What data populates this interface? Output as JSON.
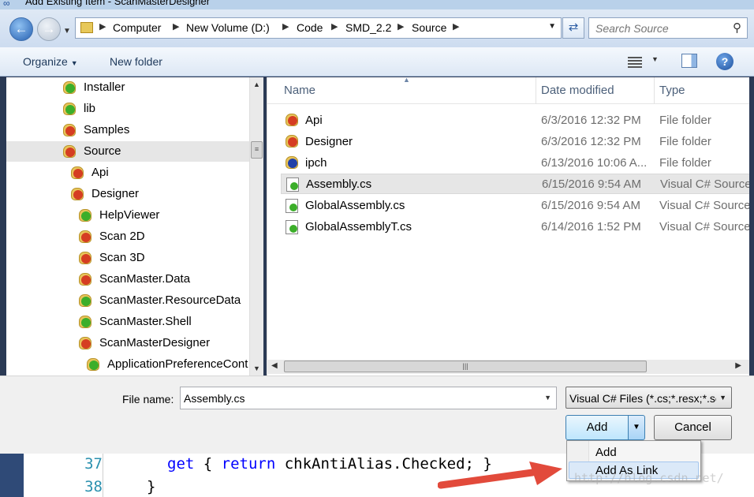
{
  "window": {
    "title": "Add Existing Item - ScanMasterDesigner"
  },
  "address": {
    "crumbs": [
      "Computer",
      "New Volume (D:)",
      "Code",
      "SMD_2.2",
      "Source"
    ]
  },
  "search": {
    "placeholder": "Search Source"
  },
  "toolbar": {
    "organize_label": "Organize",
    "new_folder_label": "New folder"
  },
  "tree": {
    "items": [
      {
        "label": "Installer",
        "badge": "green"
      },
      {
        "label": "lib",
        "badge": "green"
      },
      {
        "label": "Samples",
        "badge": "red"
      },
      {
        "label": "Source",
        "badge": "red",
        "selected": true
      },
      {
        "label": "Api",
        "badge": "red"
      },
      {
        "label": "Designer",
        "badge": "red"
      },
      {
        "label": "HelpViewer",
        "badge": "green"
      },
      {
        "label": "Scan 2D",
        "badge": "red"
      },
      {
        "label": "Scan 3D",
        "badge": "red"
      },
      {
        "label": "ScanMaster.Data",
        "badge": "red"
      },
      {
        "label": "ScanMaster.ResourceData",
        "badge": "green"
      },
      {
        "label": "ScanMaster.Shell",
        "badge": "green"
      },
      {
        "label": "ScanMasterDesigner",
        "badge": "red"
      },
      {
        "label": "ApplicationPreferenceCont",
        "badge": "green"
      }
    ]
  },
  "filelist": {
    "columns": {
      "name": "Name",
      "date": "Date modified",
      "type": "Type"
    },
    "rows": [
      {
        "name": "Api",
        "date": "6/3/2016 12:32 PM",
        "type": "File folder",
        "icon": "folder-red"
      },
      {
        "name": "Designer",
        "date": "6/3/2016 12:32 PM",
        "type": "File folder",
        "icon": "folder-red"
      },
      {
        "name": "ipch",
        "date": "6/13/2016 10:06 A...",
        "type": "File folder",
        "icon": "folder-blue"
      },
      {
        "name": "Assembly.cs",
        "date": "6/15/2016 9:54 AM",
        "type": "Visual C# Source",
        "icon": "cs-file-blue",
        "selected": true
      },
      {
        "name": "GlobalAssembly.cs",
        "date": "6/15/2016 9:54 AM",
        "type": "Visual C# Source",
        "icon": "cs-file"
      },
      {
        "name": "GlobalAssemblyT.cs",
        "date": "6/14/2016 1:52 PM",
        "type": "Visual C# Source",
        "icon": "cs-file-green"
      }
    ]
  },
  "bottom": {
    "filename_label": "File name:",
    "filename_value": "Assembly.cs",
    "filetype_value": "Visual C# Files (*.cs;*.resx;*.se",
    "add_label": "Add",
    "cancel_label": "Cancel"
  },
  "add_menu": {
    "items": [
      "Add",
      "Add As Link"
    ],
    "highlighted": "Add As Link"
  },
  "editor": {
    "lines": [
      {
        "number": "37",
        "kw1": "get",
        "kw2": "return",
        "rest": " chkAntiAlias.Checked; }"
      },
      {
        "number": "38",
        "text": "}"
      }
    ]
  },
  "watermark": "http://blog.csdn.net/",
  "colors": {
    "accent": "#3c7fb1",
    "arrow": "#e24a3b",
    "selection": "#e6e6e6"
  }
}
